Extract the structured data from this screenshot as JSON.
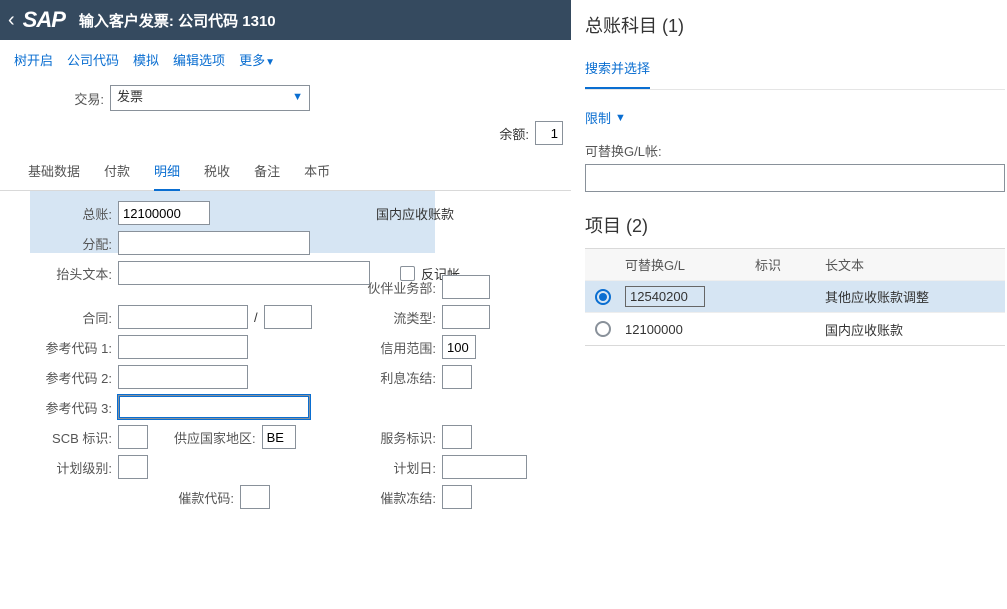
{
  "header": {
    "title": "输入客户发票: 公司代码 1310",
    "logo": "SAP"
  },
  "toolbar": {
    "tree_open": "树开启",
    "company_code": "公司代码",
    "simulate": "模拟",
    "edit_options": "编辑选项",
    "more": "更多"
  },
  "transaction": {
    "label": "交易:",
    "value": "发票"
  },
  "balance": {
    "label": "余额:",
    "value": "1"
  },
  "tabs": {
    "basic_data": "基础数据",
    "payment": "付款",
    "detail": "明细",
    "tax": "税收",
    "note": "备注",
    "local_currency": "本币"
  },
  "detail_form": {
    "gl_account": {
      "label": "总账:",
      "value": "12100000"
    },
    "gl_text": "国内应收账款",
    "assignment": {
      "label": "分配:",
      "value": ""
    },
    "header_text": {
      "label": "抬头文本:",
      "value": ""
    },
    "negative_posting": {
      "label": "反记帐"
    },
    "contract": {
      "label": "合同:",
      "value1": "",
      "value2": ""
    },
    "slash": "/",
    "ref1": {
      "label": "参考代码 1:",
      "value": ""
    },
    "ref2": {
      "label": "参考代码 2:",
      "value": ""
    },
    "ref3": {
      "label": "参考代码 3:",
      "value": ""
    },
    "scb": {
      "label": "SCB 标识:",
      "value": ""
    },
    "supply_country": {
      "label": "供应国家地区:",
      "value": "BE"
    },
    "plan_level": {
      "label": "计划级别:",
      "value": ""
    },
    "dunning_code": {
      "label": "催款代码:",
      "value": ""
    },
    "partner_ba": {
      "label": "伙伴业务部:",
      "value": ""
    },
    "flow_type": {
      "label": "流类型:",
      "value": ""
    },
    "credit_area": {
      "label": "信用范围:",
      "value": "100"
    },
    "interest_freeze": {
      "label": "利息冻结:",
      "value": ""
    },
    "service_ind": {
      "label": "服务标识:",
      "value": ""
    },
    "plan_date": {
      "label": "计划日:",
      "value": ""
    },
    "dunning_freeze": {
      "label": "催款冻结:",
      "value": ""
    }
  },
  "side": {
    "title": "总账科目 (1)",
    "search_tab": "搜索并选择",
    "restrict": "限制",
    "alt_gl_label": "可替换G/L帐:",
    "alt_gl_value": "",
    "items_title": "项目 (2)",
    "columns": {
      "alt_gl": "可替换G/L",
      "indicator": "标识",
      "long_text": "长文本"
    },
    "rows": [
      {
        "gl": "12540200",
        "indicator": "",
        "text": "其他应收账款调整",
        "selected": true
      },
      {
        "gl": "12100000",
        "indicator": "",
        "text": "国内应收账款",
        "selected": false
      }
    ]
  }
}
